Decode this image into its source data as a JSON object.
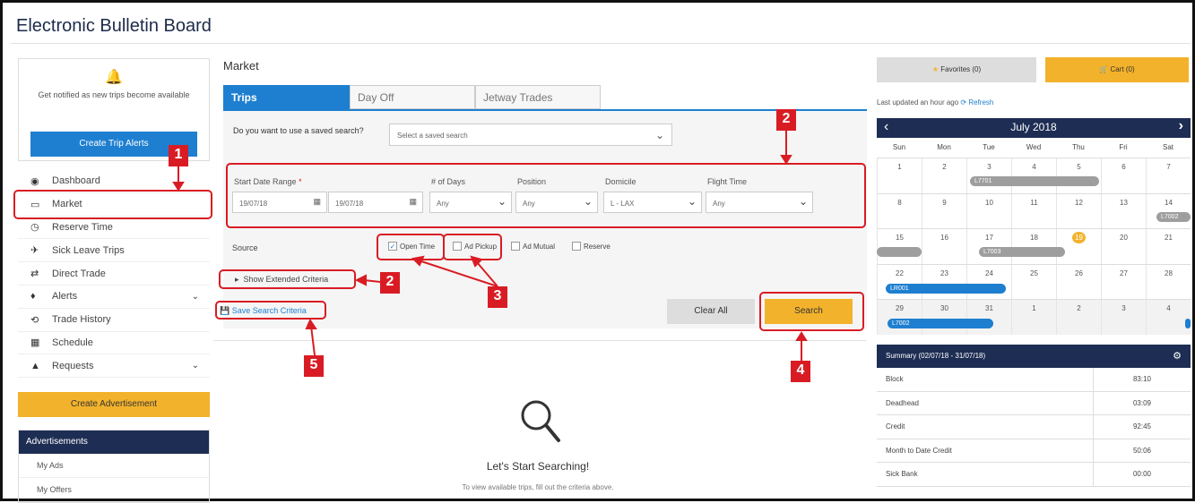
{
  "app": {
    "title": "Electronic Bulletin Board"
  },
  "sidebar": {
    "notify_text": "Get notified as new trips become available",
    "create_alerts": "Create Trip Alerts",
    "items": [
      {
        "label": "Dashboard",
        "icon": "dashboard-icon"
      },
      {
        "label": "Market",
        "icon": "market-icon"
      },
      {
        "label": "Reserve Time",
        "icon": "clock-icon"
      },
      {
        "label": "Sick Leave Trips",
        "icon": "plane-icon"
      },
      {
        "label": "Direct Trade",
        "icon": "trade-icon"
      },
      {
        "label": "Alerts",
        "icon": "bell-icon"
      },
      {
        "label": "Trade History",
        "icon": "history-icon"
      },
      {
        "label": "Schedule",
        "icon": "calendar-icon"
      },
      {
        "label": "Requests",
        "icon": "eject-icon"
      }
    ],
    "create_ad": "Create Advertisement",
    "ads": {
      "title": "Advertisements",
      "items": [
        "My Ads",
        "My Offers"
      ]
    }
  },
  "main": {
    "title": "Market",
    "tabs": [
      "Trips",
      "Day Off",
      "Jetway Trades"
    ],
    "saved_search": {
      "question": "Do you want to use a saved search?",
      "placeholder": "Select a saved search"
    },
    "filters": {
      "start_label": "Start Date Range",
      "required_mark": "*",
      "start_from": "19/07/18",
      "start_to": "19/07/18",
      "days_label": "# of Days",
      "days_value": "Any",
      "position_label": "Position",
      "position_value": "Any",
      "domicile_label": "Domicile",
      "domicile_value": "L - LAX",
      "flight_label": "Flight Time",
      "flight_value": "Any"
    },
    "source": {
      "label": "Source",
      "options": [
        {
          "label": "Open Time",
          "checked": true
        },
        {
          "label": "Ad Pickup",
          "checked": false
        },
        {
          "label": "Ad Mutual",
          "checked": false
        },
        {
          "label": "Reserve",
          "checked": false
        }
      ]
    },
    "extended": "Show Extended Criteria",
    "save_criteria": "Save Search Criteria",
    "clear": "Clear All",
    "search": "Search",
    "empty_title": "Let's Start Searching!",
    "empty_sub": "To view available trips, fill out the criteria above."
  },
  "annotations": [
    "1",
    "2",
    "2",
    "3",
    "4",
    "5"
  ],
  "right": {
    "favorites": "Favorites (0)",
    "cart": "Cart (0)",
    "updated": "Last updated an hour ago",
    "refresh": "Refresh",
    "calendar": {
      "month": "July 2018",
      "dow": [
        "Sun",
        "Mon",
        "Tue",
        "Wed",
        "Thu",
        "Fri",
        "Sat"
      ],
      "weeks": [
        [
          "1",
          "2",
          "3",
          "4",
          "5",
          "6",
          "7"
        ],
        [
          "8",
          "9",
          "10",
          "11",
          "12",
          "13",
          "14"
        ],
        [
          "15",
          "16",
          "17",
          "18",
          "19",
          "20",
          "21"
        ],
        [
          "22",
          "23",
          "24",
          "25",
          "26",
          "27",
          "28"
        ],
        [
          "29",
          "30",
          "31",
          "1",
          "2",
          "3",
          "4"
        ]
      ],
      "trips": [
        "L7701",
        "L7002",
        "L7003",
        "LR001",
        "L7002"
      ]
    },
    "summary": {
      "title": "Summary (02/07/18 - 31/07/18)",
      "rows": [
        {
          "k": "Block",
          "v": "83:10"
        },
        {
          "k": "Deadhead",
          "v": "03:09"
        },
        {
          "k": "Credit",
          "v": "92:45"
        },
        {
          "k": "Month to Date Credit",
          "v": "50:06"
        },
        {
          "k": "Sick Bank",
          "v": "00:00"
        }
      ]
    }
  },
  "colors": {
    "accent": "#1e7fd0",
    "navy": "#1d2d53",
    "gold": "#f2b22b",
    "annotation": "#d91c24"
  }
}
